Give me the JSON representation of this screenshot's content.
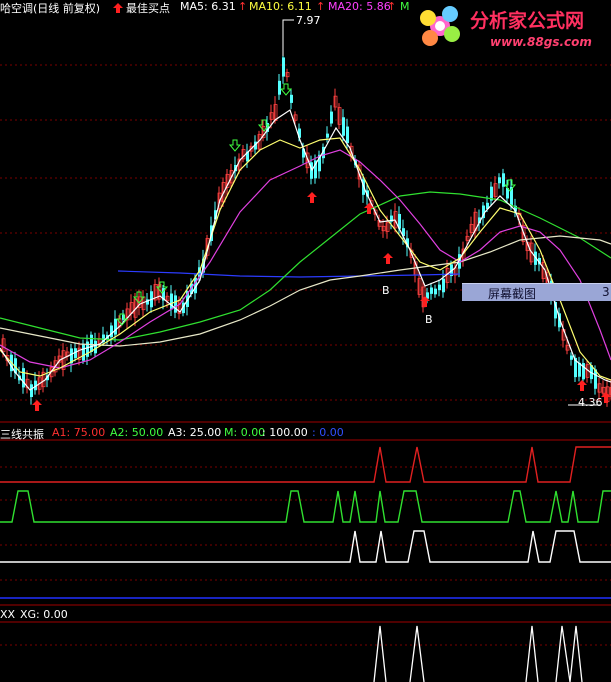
{
  "header": {
    "title": "哈空调(日线 前复权)",
    "best_buy": "最佳买点",
    "ma5": "MA5: 6.31",
    "ma10": "MA10: 6.11",
    "ma20": "MA20: 5.86",
    "ma_more": "M",
    "ma_more2": "MA"
  },
  "logo": {
    "name": "分析家公式网",
    "url": "www.88gs.com"
  },
  "price_labels": {
    "high": "7.97",
    "low": "4.36",
    "b1": "B",
    "b2": "B"
  },
  "popup": {
    "label": "屏幕截图",
    "suffix": "3"
  },
  "indicator1": {
    "name": "三线共振",
    "a1": "A1: 75.00",
    "a2": "A2: 50.00",
    "a3": "A3: 25.00",
    "m": "M: 0.00",
    "m2": ": 100.00",
    "m3": ": 0.00"
  },
  "indicator2": {
    "name": "XX",
    "xg": "XG: 0.00"
  },
  "colors": {
    "bg": "#000000",
    "up": "#ff4040",
    "down": "#54ffff",
    "ma5": "#ffffff",
    "ma10": "#ffff66",
    "ma20": "#ff40ff",
    "ma60": "#40ff40",
    "ma120": "#3040ff",
    "grid": "#800000"
  }
}
